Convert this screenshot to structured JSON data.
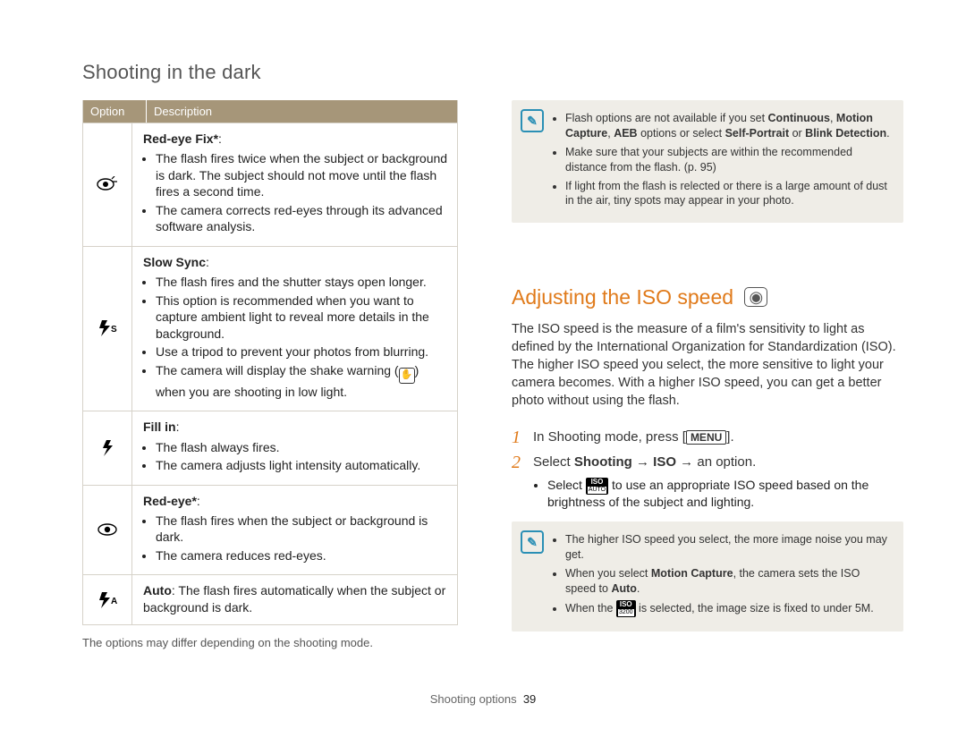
{
  "page": {
    "section_title": "Shooting in the dark",
    "footer_label": "Shooting options",
    "page_number": "39"
  },
  "table": {
    "header_option": "Option",
    "header_description": "Description",
    "footnote": "The options may differ depending on the shooting mode.",
    "rows": [
      {
        "icon_name": "red-eye-fix-icon",
        "icon_text": "👁⁺",
        "title": "Red-eye Fix*",
        "bullets": [
          "The flash fires twice when the subject or background is dark. The subject should not move until the flash fires a second time.",
          "The camera corrects red-eyes through its advanced software analysis."
        ]
      },
      {
        "icon_name": "slow-sync-icon",
        "icon_text": "⚡ S",
        "title": "Slow Sync",
        "bullets": [
          "The flash fires and the shutter stays open longer.",
          "This option is recommended when you want to capture ambient light to reveal more details in the background.",
          "Use a tripod to prevent your photos from blurring.",
          "The camera will display the shake warning (✋) when you are shooting in low light."
        ]
      },
      {
        "icon_name": "fill-in-icon",
        "icon_text": "⚡",
        "title": "Fill in",
        "bullets": [
          "The flash always fires.",
          "The camera adjusts light intensity automatically."
        ]
      },
      {
        "icon_name": "red-eye-icon",
        "icon_text": "👁",
        "title": "Red-eye*",
        "bullets": [
          "The flash fires when the subject or background is dark.",
          "The camera reduces red-eyes."
        ]
      },
      {
        "icon_name": "auto-flash-icon",
        "icon_text": "⚡ A",
        "title_inline": "Auto",
        "inline_text": ": The flash fires automatically when the subject or background is dark."
      }
    ]
  },
  "info_top": {
    "bullets": [
      {
        "prefix": "Flash options are not available if you set ",
        "bold1": "Continuous",
        "mid1": ", ",
        "bold2": "Motion Capture",
        "mid2": ", ",
        "bold3": "AEB",
        "mid3": " options or select ",
        "bold4": "Self-Portrait",
        "mid4": " or ",
        "bold5": "Blink Detection",
        "suffix": "."
      },
      {
        "text": "Make sure that your subjects are within the recommended distance from the flash. (p. 95)"
      },
      {
        "text": "If light from the flash is relected or there is a large amount of dust in the air, tiny spots may appear in your photo."
      }
    ]
  },
  "iso": {
    "heading": "Adjusting the ISO speed",
    "description": "The ISO speed is the measure of a film's sensitivity to light as defined by the International Organization for Standardization (ISO). The higher ISO speed you select, the more sensitive to light your camera becomes. With a higher ISO speed, you can get a better photo without using the flash.",
    "steps": [
      {
        "num": "1",
        "prefix": "In Shooting mode, press [",
        "menu": "MENU",
        "suffix": "]."
      },
      {
        "num": "2",
        "prefix": "Select ",
        "bold": "Shooting → ISO →",
        "suffix": " an option."
      }
    ],
    "step2_sub": {
      "prefix": "Select ",
      "iso_top": "ISO",
      "iso_bot": "AUTO",
      "suffix": " to use an appropriate ISO speed based on the brightness of the subject and lighting."
    }
  },
  "info_bottom": {
    "bullets": [
      {
        "text": "The higher ISO speed you select, the more image noise you may get."
      },
      {
        "prefix": "When you select ",
        "bold1": "Motion Capture",
        "mid": ", the camera sets the ISO speed to ",
        "bold2": "Auto",
        "suffix": "."
      },
      {
        "prefix": "When the ",
        "iso_top": "ISO",
        "iso_bot": "3200",
        "suffix": " is selected, the image size is fixed to under 5M."
      }
    ]
  }
}
